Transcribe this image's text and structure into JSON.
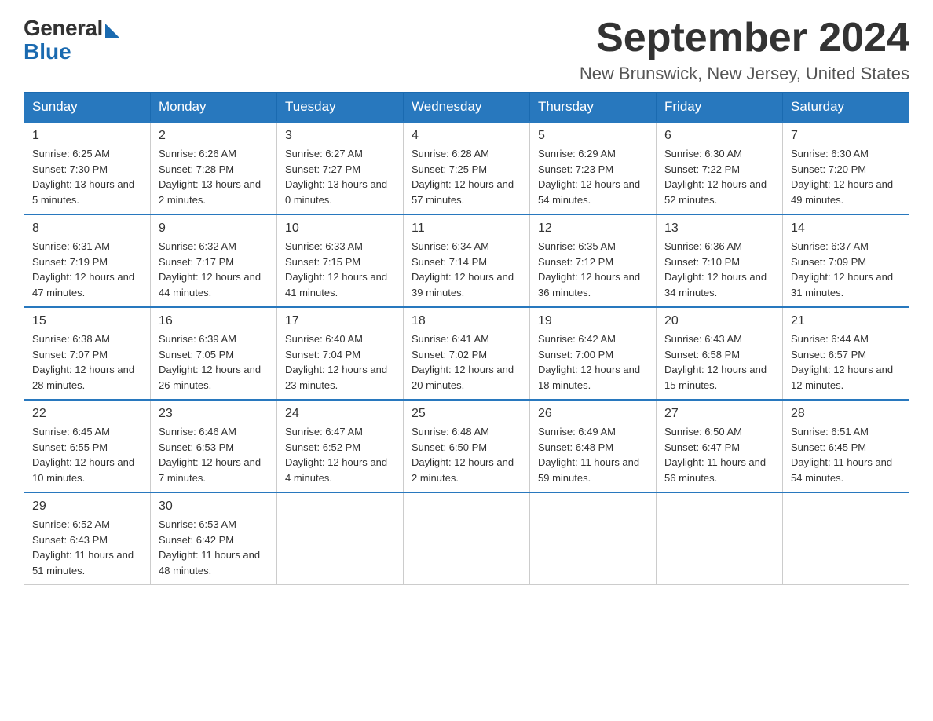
{
  "header": {
    "logo_general": "General",
    "logo_blue": "Blue",
    "month_title": "September 2024",
    "location": "New Brunswick, New Jersey, United States"
  },
  "weekdays": [
    "Sunday",
    "Monday",
    "Tuesday",
    "Wednesday",
    "Thursday",
    "Friday",
    "Saturday"
  ],
  "weeks": [
    [
      {
        "day": 1,
        "sunrise": "6:25 AM",
        "sunset": "7:30 PM",
        "daylight": "13 hours and 5 minutes."
      },
      {
        "day": 2,
        "sunrise": "6:26 AM",
        "sunset": "7:28 PM",
        "daylight": "13 hours and 2 minutes."
      },
      {
        "day": 3,
        "sunrise": "6:27 AM",
        "sunset": "7:27 PM",
        "daylight": "13 hours and 0 minutes."
      },
      {
        "day": 4,
        "sunrise": "6:28 AM",
        "sunset": "7:25 PM",
        "daylight": "12 hours and 57 minutes."
      },
      {
        "day": 5,
        "sunrise": "6:29 AM",
        "sunset": "7:23 PM",
        "daylight": "12 hours and 54 minutes."
      },
      {
        "day": 6,
        "sunrise": "6:30 AM",
        "sunset": "7:22 PM",
        "daylight": "12 hours and 52 minutes."
      },
      {
        "day": 7,
        "sunrise": "6:30 AM",
        "sunset": "7:20 PM",
        "daylight": "12 hours and 49 minutes."
      }
    ],
    [
      {
        "day": 8,
        "sunrise": "6:31 AM",
        "sunset": "7:19 PM",
        "daylight": "12 hours and 47 minutes."
      },
      {
        "day": 9,
        "sunrise": "6:32 AM",
        "sunset": "7:17 PM",
        "daylight": "12 hours and 44 minutes."
      },
      {
        "day": 10,
        "sunrise": "6:33 AM",
        "sunset": "7:15 PM",
        "daylight": "12 hours and 41 minutes."
      },
      {
        "day": 11,
        "sunrise": "6:34 AM",
        "sunset": "7:14 PM",
        "daylight": "12 hours and 39 minutes."
      },
      {
        "day": 12,
        "sunrise": "6:35 AM",
        "sunset": "7:12 PM",
        "daylight": "12 hours and 36 minutes."
      },
      {
        "day": 13,
        "sunrise": "6:36 AM",
        "sunset": "7:10 PM",
        "daylight": "12 hours and 34 minutes."
      },
      {
        "day": 14,
        "sunrise": "6:37 AM",
        "sunset": "7:09 PM",
        "daylight": "12 hours and 31 minutes."
      }
    ],
    [
      {
        "day": 15,
        "sunrise": "6:38 AM",
        "sunset": "7:07 PM",
        "daylight": "12 hours and 28 minutes."
      },
      {
        "day": 16,
        "sunrise": "6:39 AM",
        "sunset": "7:05 PM",
        "daylight": "12 hours and 26 minutes."
      },
      {
        "day": 17,
        "sunrise": "6:40 AM",
        "sunset": "7:04 PM",
        "daylight": "12 hours and 23 minutes."
      },
      {
        "day": 18,
        "sunrise": "6:41 AM",
        "sunset": "7:02 PM",
        "daylight": "12 hours and 20 minutes."
      },
      {
        "day": 19,
        "sunrise": "6:42 AM",
        "sunset": "7:00 PM",
        "daylight": "12 hours and 18 minutes."
      },
      {
        "day": 20,
        "sunrise": "6:43 AM",
        "sunset": "6:58 PM",
        "daylight": "12 hours and 15 minutes."
      },
      {
        "day": 21,
        "sunrise": "6:44 AM",
        "sunset": "6:57 PM",
        "daylight": "12 hours and 12 minutes."
      }
    ],
    [
      {
        "day": 22,
        "sunrise": "6:45 AM",
        "sunset": "6:55 PM",
        "daylight": "12 hours and 10 minutes."
      },
      {
        "day": 23,
        "sunrise": "6:46 AM",
        "sunset": "6:53 PM",
        "daylight": "12 hours and 7 minutes."
      },
      {
        "day": 24,
        "sunrise": "6:47 AM",
        "sunset": "6:52 PM",
        "daylight": "12 hours and 4 minutes."
      },
      {
        "day": 25,
        "sunrise": "6:48 AM",
        "sunset": "6:50 PM",
        "daylight": "12 hours and 2 minutes."
      },
      {
        "day": 26,
        "sunrise": "6:49 AM",
        "sunset": "6:48 PM",
        "daylight": "11 hours and 59 minutes."
      },
      {
        "day": 27,
        "sunrise": "6:50 AM",
        "sunset": "6:47 PM",
        "daylight": "11 hours and 56 minutes."
      },
      {
        "day": 28,
        "sunrise": "6:51 AM",
        "sunset": "6:45 PM",
        "daylight": "11 hours and 54 minutes."
      }
    ],
    [
      {
        "day": 29,
        "sunrise": "6:52 AM",
        "sunset": "6:43 PM",
        "daylight": "11 hours and 51 minutes."
      },
      {
        "day": 30,
        "sunrise": "6:53 AM",
        "sunset": "6:42 PM",
        "daylight": "11 hours and 48 minutes."
      },
      null,
      null,
      null,
      null,
      null
    ]
  ],
  "labels": {
    "sunrise": "Sunrise:",
    "sunset": "Sunset:",
    "daylight": "Daylight:"
  }
}
